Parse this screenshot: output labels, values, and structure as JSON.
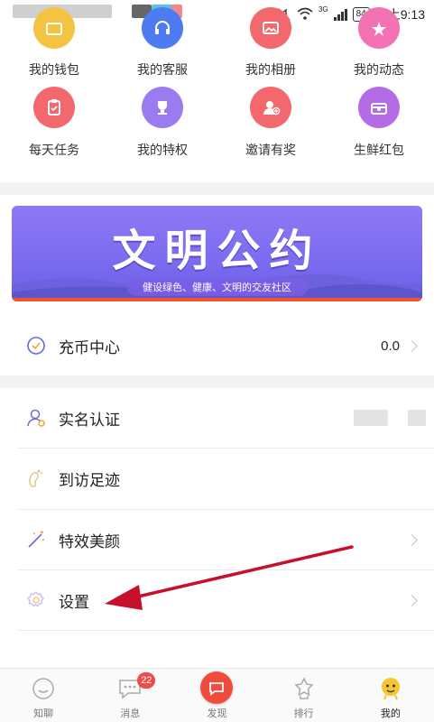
{
  "status_bar": {
    "network_type": "3G",
    "battery": "84",
    "time": "晚上9:13"
  },
  "quick_grid": {
    "row1": [
      {
        "label": "我的钱包",
        "icon": "wallet-icon",
        "color": "#f5c342"
      },
      {
        "label": "我的客服",
        "icon": "headset-icon",
        "color": "#4c7cf0"
      },
      {
        "label": "我的相册",
        "icon": "album-icon",
        "color": "#f2686c"
      },
      {
        "label": "我的动态",
        "icon": "activity-icon",
        "color": "#f372b4"
      }
    ],
    "row2": [
      {
        "label": "每天任务",
        "icon": "task-icon",
        "color": "#f2686c"
      },
      {
        "label": "我的特权",
        "icon": "trophy-icon",
        "color": "#9a7bf0"
      },
      {
        "label": "邀请有奖",
        "icon": "invite-user-icon",
        "color": "#f2686c"
      },
      {
        "label": "生鲜红包",
        "icon": "gift-box-icon",
        "color": "#b46ce6"
      }
    ]
  },
  "banner": {
    "title": "文明公约",
    "subtitle": "健设绿色、健康、文明的交友社区"
  },
  "recharge": {
    "label": "充币中心",
    "value": "0.0"
  },
  "menu": {
    "items": [
      {
        "label": "实名认证",
        "icon": "user-verify-icon"
      },
      {
        "label": "到访足迹",
        "icon": "footprint-icon"
      },
      {
        "label": "特效美颜",
        "icon": "magic-wand-icon"
      },
      {
        "label": "设置",
        "icon": "settings-gear-icon"
      }
    ]
  },
  "bottom_nav": {
    "items": [
      {
        "label": "知聊",
        "icon": "smiley-icon"
      },
      {
        "label": "消息",
        "icon": "message-icon",
        "badge": "22"
      },
      {
        "label": "发现",
        "icon": "discover-icon"
      },
      {
        "label": "排行",
        "icon": "ranking-icon"
      },
      {
        "label": "我的",
        "icon": "profile-icon"
      }
    ],
    "active_index": 4
  },
  "colors": {
    "banner_purple": "#7c6cf0",
    "accent_red": "#f04b3c",
    "annotation_arrow": "#c8102e"
  }
}
